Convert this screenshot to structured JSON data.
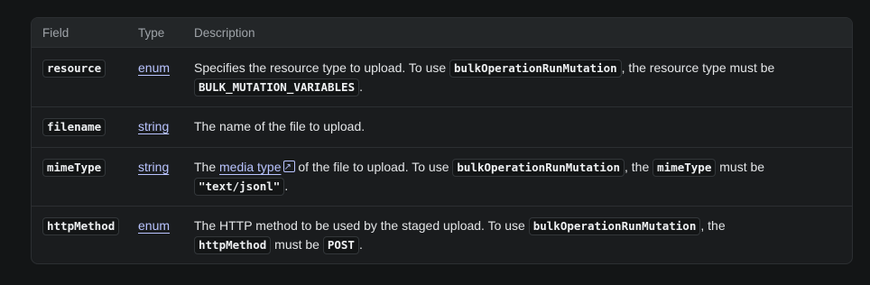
{
  "header": {
    "field": "Field",
    "type": "Type",
    "description": "Description"
  },
  "rows": [
    {
      "field": "resource",
      "type": "enum",
      "desc": {
        "t1": "Specifies the resource type to upload. To use ",
        "c1": "bulkOperationRunMutation",
        "t2": ", the resource type must be",
        "c2": "BULK_MUTATION_VARIABLES",
        "t3": "."
      }
    },
    {
      "field": "filename",
      "type": "string",
      "desc": {
        "t1": "The name of the file to upload."
      }
    },
    {
      "field": "mimeType",
      "type": "string",
      "desc": {
        "t1": "The ",
        "link": "media type",
        "t2": " of the file to upload. To use ",
        "c1": "bulkOperationRunMutation",
        "t3": ", the ",
        "c2": "mimeType",
        "t4": " must be",
        "c3": "\"text/jsonl\"",
        "t5": "."
      }
    },
    {
      "field": "httpMethod",
      "type": "enum",
      "desc": {
        "t1": "The HTTP method to be used by the staged upload. To use ",
        "c1": "bulkOperationRunMutation",
        "t2": ", the",
        "c2": "httpMethod",
        "t3": " must be ",
        "c3": "POST",
        "t4": "."
      }
    }
  ]
}
